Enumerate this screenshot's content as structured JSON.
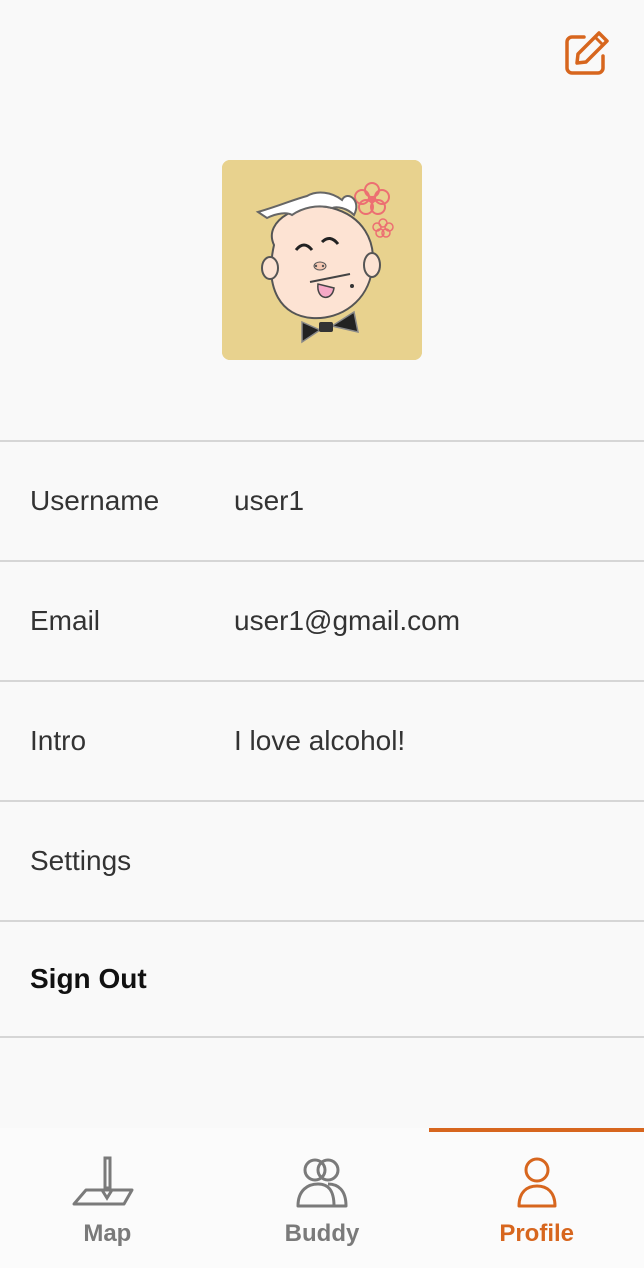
{
  "colors": {
    "accent": "#d7661e",
    "background": "#f9f9f9",
    "divider": "#d6d6d6",
    "avatar_bg": "#e8d28e",
    "inactive_tab": "#7a7a7a"
  },
  "header": {
    "edit_icon": "edit-square-pencil-icon"
  },
  "profile": {
    "avatar": "cartoon-avatar-old-man-with-bowtie"
  },
  "fields": [
    {
      "label": "Username",
      "value": "user1"
    },
    {
      "label": "Email",
      "value": "user1@gmail.com"
    },
    {
      "label": "Intro",
      "value": "I love alcohol!"
    },
    {
      "label": "Settings",
      "value": ""
    },
    {
      "label": "Sign Out",
      "value": ""
    }
  ],
  "tabs": [
    {
      "label": "Map",
      "icon": "map-pin-icon",
      "active": false
    },
    {
      "label": "Buddy",
      "icon": "buddy-people-icon",
      "active": false
    },
    {
      "label": "Profile",
      "icon": "profile-person-icon",
      "active": true
    }
  ]
}
